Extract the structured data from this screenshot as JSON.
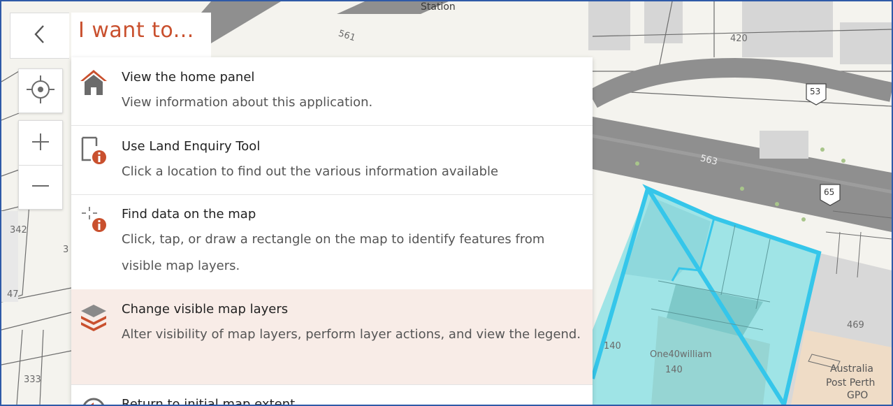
{
  "panel": {
    "title": "I want to...",
    "items": [
      {
        "title": "View the home panel",
        "desc": "View information about this application.",
        "icon": "home-icon"
      },
      {
        "title": "Use Land Enquiry Tool",
        "desc": "Click a location to find out the various information available",
        "icon": "land-enquiry-icon"
      },
      {
        "title": "Find data on the map",
        "desc": "Click, tap, or draw a rectangle on the map to identify features from visible map layers.",
        "icon": "identify-icon"
      },
      {
        "title": "Change visible map layers",
        "desc": "Alter visibility of map layers, perform layer actions, and view the legend.",
        "icon": "layers-icon"
      },
      {
        "title": "Return to initial map extent",
        "desc": "",
        "icon": "return-extent-icon"
      }
    ]
  },
  "controls": {
    "back": "back-chevron-icon",
    "locate": "locate-icon",
    "zoom_in": "plus-icon",
    "zoom_out": "minus-icon"
  },
  "map": {
    "labels": {
      "street_top": "Station",
      "num_561": "561",
      "num_420": "420",
      "route_53": "53",
      "num_563": "563",
      "route_65": "65",
      "num_342": "342",
      "num_3": "3",
      "num_47": "47",
      "num_333": "333",
      "num_469": "469",
      "num_140a": "140",
      "one40": "One40william",
      "num_140b": "140",
      "australia": "Australia",
      "post_perth": "Post Perth",
      "gpo": "GPO"
    }
  },
  "colors": {
    "accent": "#c9502e",
    "parcel_highlight": "#35c6ea",
    "parcel_fill": "#9fe4e6",
    "road": "#8f8f8f",
    "selected_row": "#f8ece7"
  }
}
